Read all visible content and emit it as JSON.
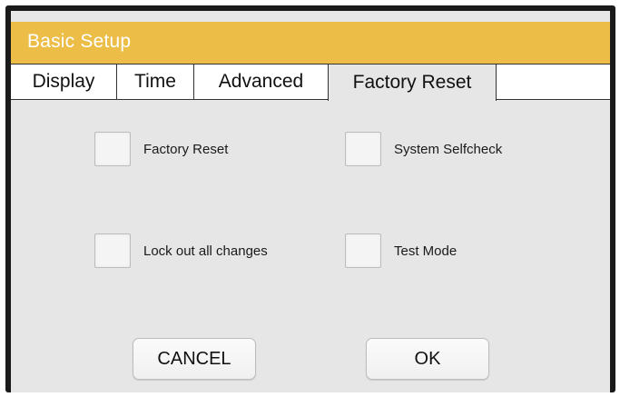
{
  "window": {
    "title": "Basic Setup"
  },
  "tabs": [
    {
      "label": "Display"
    },
    {
      "label": "Time"
    },
    {
      "label": "Advanced"
    },
    {
      "label": "Factory Reset",
      "active": true
    }
  ],
  "options": [
    {
      "label": "Factory Reset",
      "checked": false
    },
    {
      "label": "System Selfcheck",
      "checked": false
    },
    {
      "label": "Lock out all changes",
      "checked": false
    },
    {
      "label": "Test Mode",
      "checked": false
    }
  ],
  "buttons": {
    "cancel_label": "CANCEL",
    "ok_label": "OK"
  },
  "colors": {
    "titlebar": "#ecbd47",
    "panel": "#e6e6e6",
    "frame": "#1a1a1a"
  }
}
